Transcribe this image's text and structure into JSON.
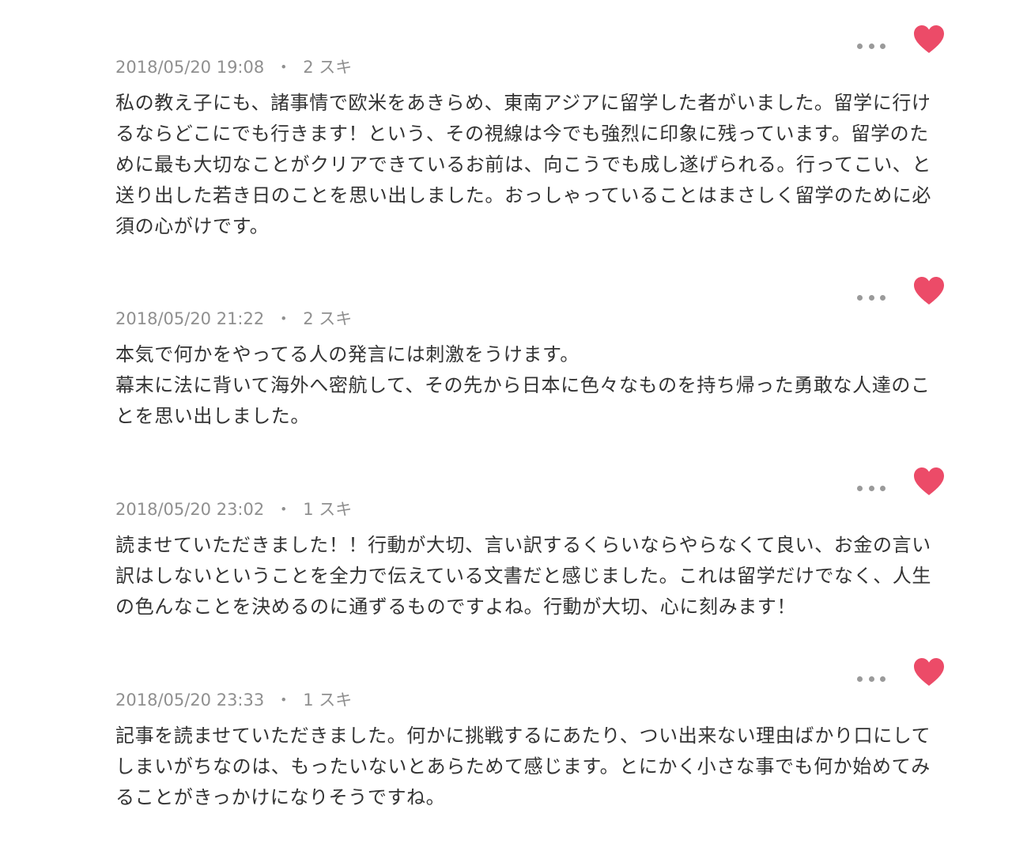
{
  "colors": {
    "heart": "#ec4b68",
    "meta_text": "#8f8f8f",
    "body_text": "#333333",
    "menu_dots": "#9a9a9a"
  },
  "comments": [
    {
      "date": "2018/05/20 19:08",
      "separator": "・",
      "likes": "2 スキ",
      "body": "私の教え子にも、諸事情で欧米をあきらめ、東南アジアに留学した者がいました。留学に行けるならどこにでも行きます！という、その視線は今でも強烈に印象に残っています。留学のために最も大切なことがクリアできているお前は、向こうでも成し遂げられる。行ってこい、と送り出した若き日のことを思い出しました。おっしゃっていることはまさしく留学のために必須の心がけです。",
      "like_icon": "heart-icon",
      "menu_icon": "more-horizontal-icon"
    },
    {
      "date": "2018/05/20 21:22",
      "separator": "・",
      "likes": "2 スキ",
      "body": "本気で何かをやってる人の発言には刺激をうけます。\n幕末に法に背いて海外へ密航して、その先から日本に色々なものを持ち帰った勇敢な人達のことを思い出しました。",
      "like_icon": "heart-icon",
      "menu_icon": "more-horizontal-icon"
    },
    {
      "date": "2018/05/20 23:02",
      "separator": "・",
      "likes": "1 スキ",
      "body": "読ませていただきました！！行動が大切、言い訳するくらいならやらなくて良い、お金の言い訳はしないということを全力で伝えている文書だと感じました。これは留学だけでなく、人生の色んなことを決めるのに通ずるものですよね。行動が大切、心に刻みます！",
      "like_icon": "heart-icon",
      "menu_icon": "more-horizontal-icon"
    },
    {
      "date": "2018/05/20 23:33",
      "separator": "・",
      "likes": "1 スキ",
      "body": "記事を読ませていただきました。何かに挑戦するにあたり、つい出来ない理由ばかり口にしてしまいがちなのは、もったいないとあらためて感じます。とにかく小さな事でも何か始めてみることがきっかけになりそうですね。",
      "like_icon": "heart-icon",
      "menu_icon": "more-horizontal-icon"
    }
  ]
}
